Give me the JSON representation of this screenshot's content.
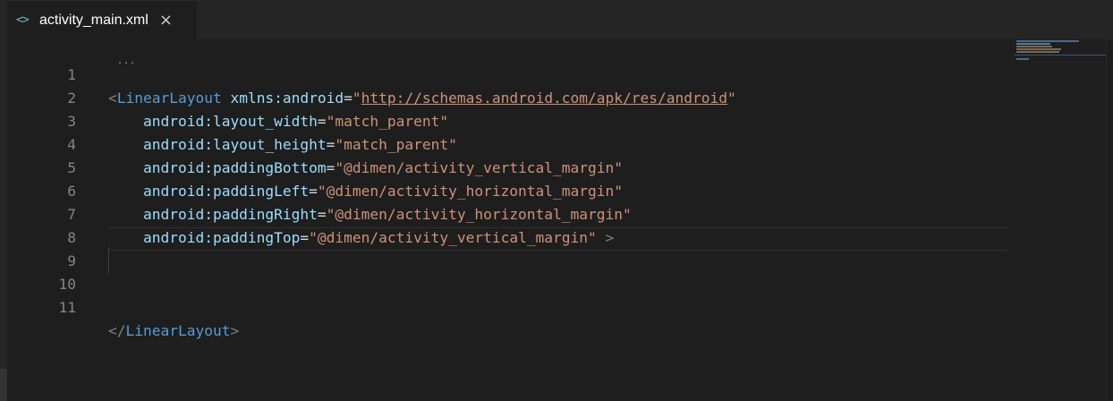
{
  "tab": {
    "icon": "code-brackets-icon",
    "icon_glyph": "<>",
    "title": "activity_main.xml",
    "close_glyph": "×"
  },
  "editor": {
    "line_numbers": [
      "1",
      "2",
      "3",
      "4",
      "5",
      "6",
      "7",
      "8",
      "9",
      "10",
      "11"
    ],
    "fold_dots": "...",
    "lines": {
      "l1": {
        "open": "<",
        "tag": "LinearLayout",
        "sp": " ",
        "attr": "xmlns:android",
        "eq": "=",
        "q1": "\"",
        "url": "http://schemas.android.com/apk/res/android",
        "q2": "\""
      },
      "l2": {
        "indent": "    ",
        "attr": "android:layout_width",
        "eq": "=",
        "val": "\"match_parent\""
      },
      "l3": {
        "indent": "    ",
        "attr": "android:layout_height",
        "eq": "=",
        "val": "\"match_parent\""
      },
      "l4": {
        "indent": "    ",
        "attr": "android:paddingBottom",
        "eq": "=",
        "val": "\"@dimen/activity_vertical_margin\""
      },
      "l5": {
        "indent": "    ",
        "attr": "android:paddingLeft",
        "eq": "=",
        "val": "\"@dimen/activity_horizontal_margin\""
      },
      "l6": {
        "indent": "    ",
        "attr": "android:paddingRight",
        "eq": "=",
        "val": "\"@dimen/activity_horizontal_margin\""
      },
      "l7": {
        "indent": "    ",
        "attr": "android:paddingTop",
        "eq": "=",
        "val": "\"@dimen/activity_vertical_margin\"",
        "close": " >"
      },
      "l11": {
        "open": "</",
        "tag": "LinearLayout",
        "close": ">"
      }
    }
  },
  "colors": {
    "background": "#1e1e1e",
    "tag": "#569cd6",
    "attribute": "#9cdcfe",
    "string": "#ce9178",
    "punctuation": "#808080",
    "line_number": "#858585"
  }
}
